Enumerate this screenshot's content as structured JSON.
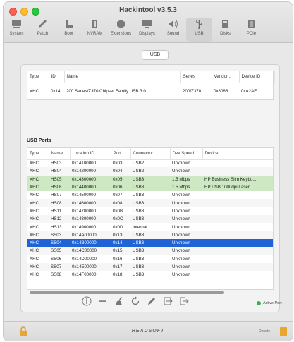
{
  "window": {
    "title": "Hackintool v3.5.3"
  },
  "toolbar": {
    "items": [
      {
        "label": "System",
        "icon": "monitor-icon"
      },
      {
        "label": "Patch",
        "icon": "pencil-icon"
      },
      {
        "label": "Boot",
        "icon": "boot-icon"
      },
      {
        "label": "NVRAM",
        "icon": "chip-icon"
      },
      {
        "label": "Extensions",
        "icon": "extensions-icon"
      },
      {
        "label": "Displays",
        "icon": "display-icon"
      },
      {
        "label": "Sound",
        "icon": "speaker-icon"
      },
      {
        "label": "USB",
        "icon": "usb-icon"
      },
      {
        "label": "Disks",
        "icon": "disk-icon"
      },
      {
        "label": "PCIe",
        "icon": "pcie-icon"
      }
    ],
    "active": "USB"
  },
  "segment": {
    "label": "USB"
  },
  "controllers": {
    "headers": [
      "Type",
      "ID",
      "Name",
      "Series",
      "Vendor...",
      "Device ID"
    ],
    "rows": [
      [
        "XHC",
        "0x14",
        "200 Series/Z370 Chipset Family USB 3.0...",
        "200/Z370",
        "0x8086",
        "0xA2AF"
      ]
    ]
  },
  "ports": {
    "title": "USB Ports",
    "headers": [
      "Type",
      "Name",
      "Location ID",
      "Port",
      "Connector",
      "Dev Speed",
      "Device"
    ],
    "rows": [
      {
        "type": "XHC",
        "name": "HS03",
        "location": "0x14100000",
        "port": "0x03",
        "connector": "USB2",
        "speed": "Unknown",
        "device": "",
        "hl": ""
      },
      {
        "type": "XHC",
        "name": "HS04",
        "location": "0x14200000",
        "port": "0x04",
        "connector": "USB2",
        "speed": "Unknown",
        "device": "",
        "hl": ""
      },
      {
        "type": "XHC",
        "name": "HS05",
        "location": "0x14300000",
        "port": "0x05",
        "connector": "USB3",
        "speed": "1.5 Mbps",
        "device": "HP Business Slim Keybo...",
        "hl": "green"
      },
      {
        "type": "XHC",
        "name": "HS06",
        "location": "0x14400000",
        "port": "0x06",
        "connector": "USB3",
        "speed": "1.5 Mbps",
        "device": "HP USB 1000dpi Laser...",
        "hl": "green"
      },
      {
        "type": "XHC",
        "name": "HS07",
        "location": "0x14500000",
        "port": "0x07",
        "connector": "USB3",
        "speed": "Unknown",
        "device": "",
        "hl": ""
      },
      {
        "type": "XHC",
        "name": "HS08",
        "location": "0x14600000",
        "port": "0x08",
        "connector": "USB3",
        "speed": "Unknown",
        "device": "",
        "hl": ""
      },
      {
        "type": "XHC",
        "name": "HS11",
        "location": "0x14700000",
        "port": "0x0B",
        "connector": "USB3",
        "speed": "Unknown",
        "device": "",
        "hl": ""
      },
      {
        "type": "XHC",
        "name": "HS12",
        "location": "0x14800000",
        "port": "0x0C",
        "connector": "USB3",
        "speed": "Unknown",
        "device": "",
        "hl": ""
      },
      {
        "type": "XHC",
        "name": "HS13",
        "location": "0x14900000",
        "port": "0x0D",
        "connector": "Internal",
        "speed": "Unknown",
        "device": "",
        "hl": ""
      },
      {
        "type": "XHC",
        "name": "SS03",
        "location": "0x14A00000",
        "port": "0x13",
        "connector": "USB3",
        "speed": "Unknown",
        "device": "",
        "hl": ""
      },
      {
        "type": "XHC",
        "name": "SS04",
        "location": "0x14B00000",
        "port": "0x14",
        "connector": "USB3",
        "speed": "Unknown",
        "device": "",
        "hl": "blue"
      },
      {
        "type": "XHC",
        "name": "SS05",
        "location": "0x14C00000",
        "port": "0x15",
        "connector": "USB3",
        "speed": "Unknown",
        "device": "",
        "hl": ""
      },
      {
        "type": "XHC",
        "name": "SS06",
        "location": "0x14D00000",
        "port": "0x16",
        "connector": "USB3",
        "speed": "Unknown",
        "device": "",
        "hl": ""
      },
      {
        "type": "XHC",
        "name": "SS07",
        "location": "0x14E00000",
        "port": "0x17",
        "connector": "USB3",
        "speed": "Unknown",
        "device": "",
        "hl": ""
      },
      {
        "type": "XHC",
        "name": "SS08",
        "location": "0x14F00000",
        "port": "0x18",
        "connector": "USB3",
        "speed": "Unknown",
        "device": "",
        "hl": ""
      }
    ]
  },
  "status": {
    "active_port_label": "Active Port",
    "active_color": "#2bb84a"
  },
  "bottom_tools": [
    "info-icon",
    "minus-icon",
    "broom-icon",
    "refresh-icon",
    "pencil-icon",
    "import-icon",
    "export-icon"
  ],
  "footer": {
    "brand": "HEADSOFT",
    "donate_label": "Donate"
  },
  "colors": {
    "selection": "#1f63d6",
    "connected": "#cde8c3"
  }
}
